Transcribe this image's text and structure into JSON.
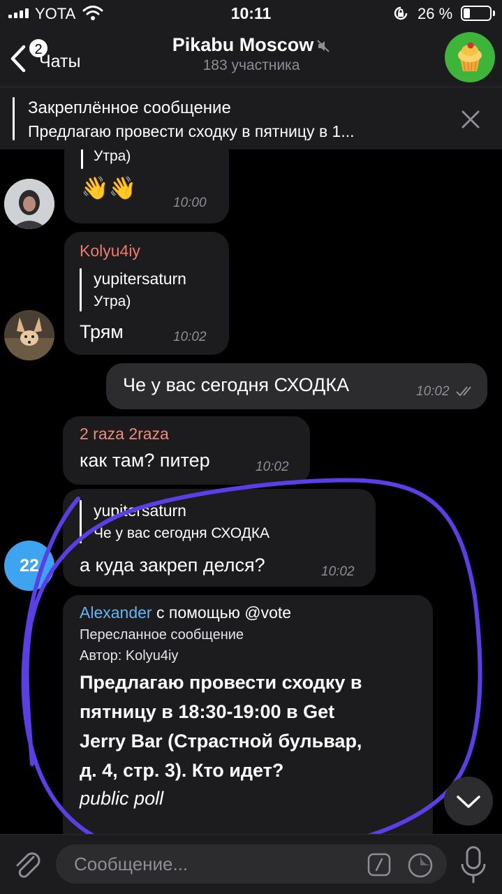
{
  "status_bar": {
    "carrier": "YOTA",
    "time": "10:11",
    "battery_percent": "26 %",
    "battery_level": 0.26
  },
  "header": {
    "back_label": "Чаты",
    "unread_badge": "2",
    "title": "Pikabu Moscow",
    "subtitle": "183 участника"
  },
  "pinned": {
    "title": "Закреплённое сообщение",
    "text": "Предлагаю провести сходку в пятницу в 1..."
  },
  "messages": [
    {
      "reply_text": "Утра)",
      "text": "👋👋",
      "time": "10:00"
    },
    {
      "sender": "Kolyu4iy",
      "reply_name": "yupitersaturn",
      "reply_text": "Утра)",
      "text": "Трям",
      "time": "10:02"
    },
    {
      "text": "Че у вас сегодня СХОДКА",
      "time": "10:02"
    },
    {
      "sender": "2 raza 2raza",
      "text": "как там? питер",
      "time": "10:02"
    },
    {
      "reply_name": "yupitersaturn",
      "reply_text": "Че у вас сегодня СХОДКА",
      "text": "а куда закреп делся?",
      "time": "10:02",
      "avatar_label": "22"
    },
    {
      "sender": "Alexander",
      "via": "с помощью @vote",
      "forwarded_label": "Пересланное сообщение",
      "author_label": "Автор: Kolyu4iy",
      "poll_question_lines": [
        "Предлагаю провести сходку в",
        "пятницу в 18:30-19:00 в Get",
        "Jerry Bar (Страстной бульвар,",
        "д. 4, стр. 3). Кто идет?"
      ],
      "poll_type": "public poll"
    }
  ],
  "input": {
    "placeholder": "Сообщение..."
  },
  "colors": {
    "background": "#000000",
    "bar": "#1c1c1e",
    "bubble_in": "#1c1c1e",
    "bubble_out": "#2c2c2e",
    "sender_kolyu4iy": "#ef7a6b",
    "sender_2raza": "#f08a7a",
    "sender_alexander": "#64b5f6",
    "avatar_22": "#3fa4f0",
    "annotation": "#5b3ee6"
  },
  "icons": [
    "signal-icon",
    "wifi-icon",
    "rotation-lock-icon",
    "battery-icon",
    "back-chevron-icon",
    "mute-icon",
    "close-icon",
    "read-checkmarks-icon",
    "chevron-down-icon",
    "paperclip-icon",
    "command-icon",
    "sticker-icon",
    "microphone-icon"
  ]
}
